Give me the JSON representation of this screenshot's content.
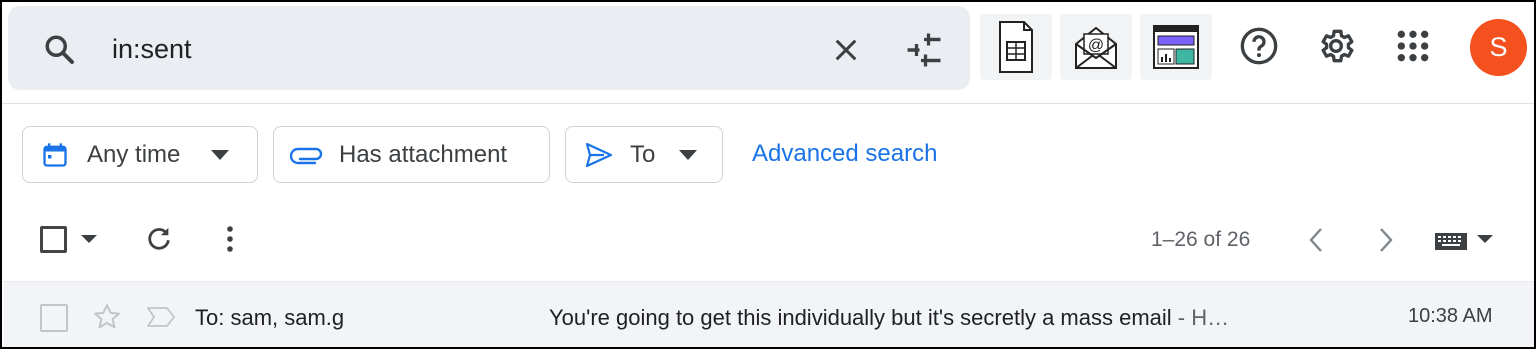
{
  "search": {
    "query": "in:sent",
    "icon": "search-icon",
    "clear_icon": "close-icon",
    "options_icon": "tune-icon"
  },
  "header": {
    "addons": [
      "sheets-addon-icon",
      "mail-addon-icon",
      "dashboard-addon-icon"
    ],
    "help_icon": "help-icon",
    "settings_icon": "gear-icon",
    "apps_icon": "apps-grid-icon",
    "avatar_letter": "S",
    "avatar_color": "#f4511e"
  },
  "filters": {
    "chips": [
      {
        "label": "Any time"
      },
      {
        "label": "Has attachment"
      },
      {
        "label": "To"
      }
    ],
    "advanced_search": "Advanced search",
    "accent": "#1a73e8"
  },
  "toolbar": {
    "pagination": "1–26 of 26"
  },
  "emails": [
    {
      "sender": "To: sam, sam.g",
      "subject": "You're going to get this individually but it's secretly a mass email",
      "snippet": " - H…",
      "time": "10:38 AM"
    }
  ]
}
